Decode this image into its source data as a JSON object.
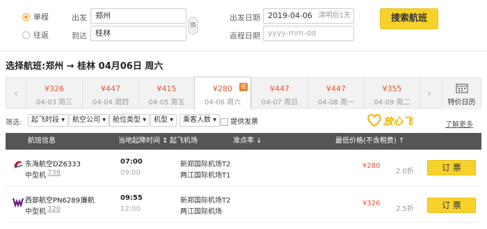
{
  "search": {
    "trip_types": [
      {
        "label": "单程",
        "selected": true
      },
      {
        "label": "往返",
        "selected": false
      }
    ],
    "depart_label": "出发",
    "depart_value": "郑州",
    "arrive_label": "到达",
    "arrive_value": "桂林",
    "swap_label": "换",
    "depart_date_label": "出发日期",
    "depart_date_value": "2019-04-06",
    "depart_date_hint": "清明后1天",
    "return_date_label": "返程日期",
    "return_date_placeholder": "yyyy-mm-dd",
    "search_button": "搜索航班"
  },
  "route_title": "选择航班:郑州 → 桂林 04月06日 周六",
  "date_strip": {
    "prev": "‹",
    "next": "›",
    "days": [
      {
        "price": "¥326",
        "date": "04-03 周三",
        "selected": false
      },
      {
        "price": "¥447",
        "date": "04-04 周四",
        "selected": false
      },
      {
        "price": "¥415",
        "date": "04-05 周五",
        "selected": false
      },
      {
        "price": "¥280",
        "date": "04-06 周六",
        "selected": true,
        "tag": "低"
      },
      {
        "price": "¥447",
        "date": "04-07 周日",
        "selected": false
      },
      {
        "price": "¥447",
        "date": "04-08 周一",
        "selected": false
      },
      {
        "price": "¥355",
        "date": "04-09 周二",
        "selected": false
      }
    ],
    "calendar_label": "特价日历"
  },
  "filters": {
    "label": "筛选:",
    "items": [
      "起飞时段",
      "航空公司",
      "舱位类型",
      "机型",
      "乘客人数"
    ],
    "checkbox_label": "提供发票",
    "promo_logo": "放心飞",
    "more_link": "了解更多"
  },
  "table": {
    "headers": {
      "info": "航班信息",
      "time": "当地起降时间",
      "airport": "起飞机场",
      "ontime": "准点率",
      "price": "最低价格(不含税费)"
    }
  },
  "flights": [
    {
      "airline": "东海航空DZ6333",
      "shared": "",
      "plane_type": "中型机",
      "plane_model": "738",
      "dep_time": "07:00",
      "arr_time": "09:00",
      "dep_airport": "新郑国际机场T2",
      "arr_airport": "两江国际机场T1",
      "price": "¥280",
      "discount": "2.0折",
      "book": "订 票",
      "logo_color": "#c8102e"
    },
    {
      "airline": "西部航空PN6289",
      "shared": "廉航",
      "plane_type": "中型机",
      "plane_model": "320",
      "dep_time": "09:55",
      "arr_time": "12:00",
      "dep_airport": "新郑国际机场T2",
      "arr_airport": "两江国际机场",
      "price": "¥326",
      "discount": "2.5折",
      "book": "订 票",
      "logo_color": "#6a1b7a"
    }
  ],
  "colors": {
    "accent": "#f8d22a",
    "price": "#e8542c",
    "header_bg": "#555555"
  }
}
